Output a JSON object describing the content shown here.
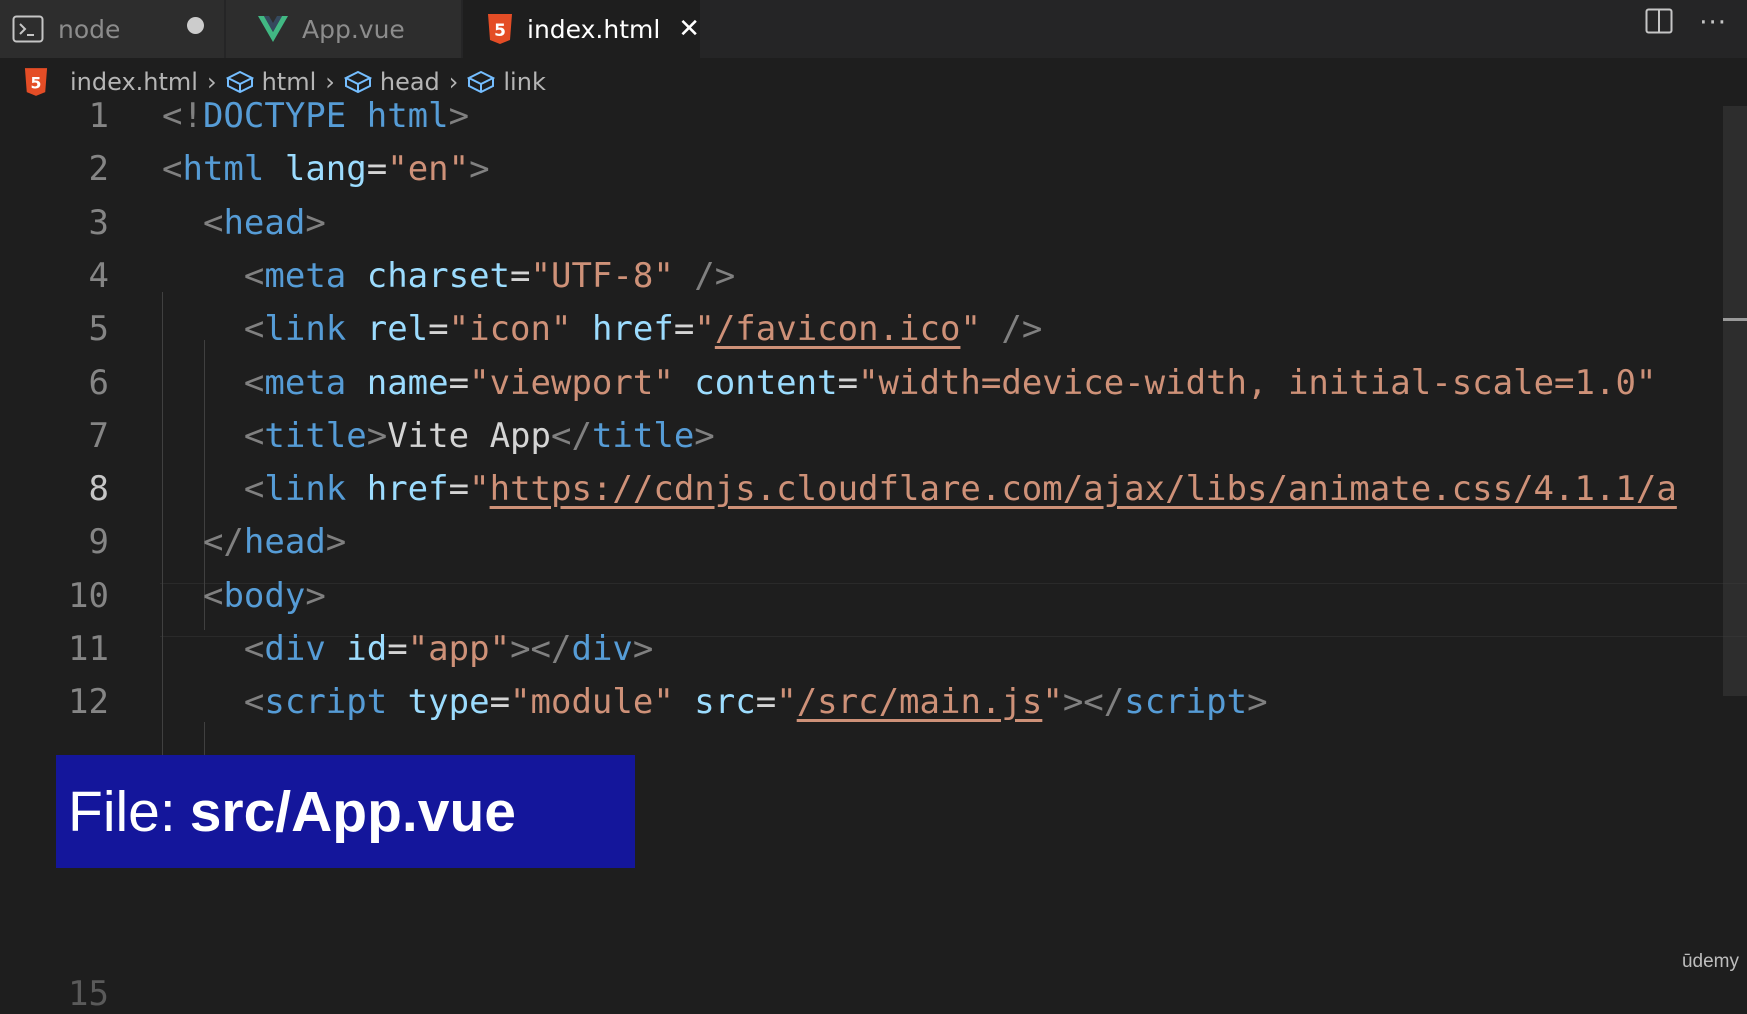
{
  "tabs": [
    {
      "label": "node",
      "icon": "terminal-icon",
      "modified": true
    },
    {
      "label": "App.vue",
      "icon": "vue-icon"
    },
    {
      "label": "index.html",
      "icon": "html5-icon",
      "active": true
    }
  ],
  "breadcrumb": [
    "index.html",
    "html",
    "head",
    "link"
  ],
  "lines": [
    {
      "num": "1",
      "tokens": [
        [
          "punct",
          "<!"
        ],
        [
          "doctype",
          "DOCTYPE "
        ],
        [
          "tag",
          "html"
        ],
        [
          "punct",
          ">"
        ]
      ]
    },
    {
      "num": "2",
      "tokens": [
        [
          "punct",
          "<"
        ],
        [
          "tag",
          "html "
        ],
        [
          "attr",
          "lang"
        ],
        [
          "text",
          "="
        ],
        [
          "str",
          "\"en\""
        ],
        [
          "punct",
          ">"
        ]
      ]
    },
    {
      "num": "3",
      "tokens": [
        [
          "text",
          "  "
        ],
        [
          "punct",
          "<"
        ],
        [
          "tag",
          "head"
        ],
        [
          "punct",
          ">"
        ]
      ]
    },
    {
      "num": "4",
      "tokens": [
        [
          "text",
          "    "
        ],
        [
          "punct",
          "<"
        ],
        [
          "tag",
          "meta "
        ],
        [
          "attr",
          "charset"
        ],
        [
          "text",
          "="
        ],
        [
          "str",
          "\"UTF-8\""
        ],
        [
          "text",
          " "
        ],
        [
          "punct",
          "/>"
        ]
      ]
    },
    {
      "num": "5",
      "tokens": [
        [
          "text",
          "    "
        ],
        [
          "punct",
          "<"
        ],
        [
          "tag",
          "link "
        ],
        [
          "attr",
          "rel"
        ],
        [
          "text",
          "="
        ],
        [
          "str",
          "\"icon\""
        ],
        [
          "text",
          " "
        ],
        [
          "attr",
          "href"
        ],
        [
          "text",
          "="
        ],
        [
          "str",
          "\""
        ],
        [
          "link",
          "/favicon.ico"
        ],
        [
          "str",
          "\""
        ],
        [
          "text",
          " "
        ],
        [
          "punct",
          "/>"
        ]
      ]
    },
    {
      "num": "6",
      "tokens": [
        [
          "text",
          "    "
        ],
        [
          "punct",
          "<"
        ],
        [
          "tag",
          "meta "
        ],
        [
          "attr",
          "name"
        ],
        [
          "text",
          "="
        ],
        [
          "str",
          "\"viewport\""
        ],
        [
          "text",
          " "
        ],
        [
          "attr",
          "content"
        ],
        [
          "text",
          "="
        ],
        [
          "str",
          "\"width=device-width, initial-scale=1.0\""
        ]
      ]
    },
    {
      "num": "7",
      "tokens": [
        [
          "text",
          "    "
        ],
        [
          "punct",
          "<"
        ],
        [
          "tag",
          "title"
        ],
        [
          "punct",
          ">"
        ],
        [
          "text",
          "Vite App"
        ],
        [
          "punct",
          "</"
        ],
        [
          "tag",
          "title"
        ],
        [
          "punct",
          ">"
        ]
      ]
    },
    {
      "num": "8",
      "tokens": [
        [
          "text",
          "    "
        ],
        [
          "punct",
          "<"
        ],
        [
          "tag",
          "link "
        ],
        [
          "attr",
          "href"
        ],
        [
          "text",
          "="
        ],
        [
          "str",
          "\""
        ],
        [
          "link",
          "https://cdnjs.cloudflare.com/ajax/libs/animate.css/4.1.1/a"
        ]
      ]
    },
    {
      "num": "9",
      "tokens": [
        [
          "text",
          "  "
        ],
        [
          "punct",
          "</"
        ],
        [
          "tag",
          "head"
        ],
        [
          "punct",
          ">"
        ]
      ]
    },
    {
      "num": "10",
      "tokens": [
        [
          "text",
          "  "
        ],
        [
          "punct",
          "<"
        ],
        [
          "tag",
          "body"
        ],
        [
          "punct",
          ">"
        ]
      ]
    },
    {
      "num": "11",
      "tokens": [
        [
          "text",
          "    "
        ],
        [
          "punct",
          "<"
        ],
        [
          "tag",
          "div "
        ],
        [
          "attr",
          "id"
        ],
        [
          "text",
          "="
        ],
        [
          "str",
          "\"app\""
        ],
        [
          "punct",
          "></"
        ],
        [
          "tag",
          "div"
        ],
        [
          "punct",
          ">"
        ]
      ]
    },
    {
      "num": "12",
      "tokens": [
        [
          "text",
          "    "
        ],
        [
          "punct",
          "<"
        ],
        [
          "tag",
          "script "
        ],
        [
          "attr",
          "type"
        ],
        [
          "text",
          "="
        ],
        [
          "str",
          "\"module\""
        ],
        [
          "text",
          " "
        ],
        [
          "attr",
          "src"
        ],
        [
          "text",
          "="
        ],
        [
          "str",
          "\""
        ],
        [
          "link",
          "/src/main.js"
        ],
        [
          "str",
          "\""
        ],
        [
          "punct",
          "></"
        ],
        [
          "tag",
          "script"
        ],
        [
          "punct",
          ">"
        ]
      ]
    }
  ],
  "hidden_line_num": "15",
  "overlay": {
    "prefix": "File:",
    "file": "src/App.vue"
  },
  "watermark": "ūdemy",
  "colors": {
    "overlay_bg": "#14169b",
    "html5": "#e44d26",
    "vue": "#41b883"
  }
}
